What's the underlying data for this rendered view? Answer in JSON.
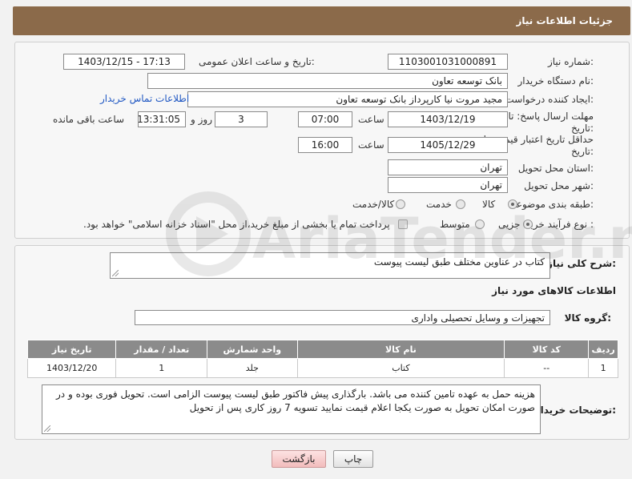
{
  "header": {
    "title": "جزئیات اطلاعات نیاز"
  },
  "form": {
    "need_number_label": "شماره نیاز:",
    "need_number": "1103001031000891",
    "announce_label": "تاریخ و ساعت اعلان عمومی:",
    "announce_value": "1403/12/15 - 17:13",
    "buyer_org_label": "نام دستگاه خریدار:",
    "buyer_org": "بانک توسعه تعاون",
    "requester_label": "ایجاد کننده درخواست:",
    "requester": "مجید مروت نیا کارپرداز بانک توسعه تعاون",
    "contact_link": "اطلاعات تماس خریدار",
    "deadline_label_1": "مهلت ارسال پاسخ: تا",
    "deadline_label_2": "تاریخ:",
    "deadline_date": "1403/12/19",
    "time_label": "ساعت",
    "deadline_time": "07:00",
    "days_value": "3",
    "days_label": "روز و",
    "remaining_time": "13:31:05",
    "remaining_label": "ساعت باقی مانده",
    "validity_label_1": "حداقل تاریخ اعتبار قیمت: تا",
    "validity_label_2": "تاریخ:",
    "validity_date": "1405/12/29",
    "validity_time": "16:00",
    "province_label": "استان محل تحویل:",
    "province": "تهران",
    "city_label": "شهر محل تحویل:",
    "city": "تهران",
    "category_label": "طبقه بندی موضوعی:",
    "category_options": [
      "کالا",
      "خدمت",
      "کالا/خدمت"
    ],
    "category_selected": "کالا",
    "process_label": "نوع فرآیند خرید :",
    "process_options": [
      "جزیی",
      "متوسط"
    ],
    "process_selected": "جزیی",
    "payment_note": "پرداخت تمام یا بخشی از مبلغ خرید،از محل \"اسناد خزانه اسلامی\" خواهد بود."
  },
  "details": {
    "summary_label": "شرح کلی نیاز:",
    "summary": "کتاب در عناوین مختلف طبق لیست پیوست",
    "goods_info_title": "اطلاعات کالاهای مورد نیاز",
    "goods_group_label": "گروه کالا:",
    "goods_group": "تجهیزات و وسایل تحصیلی واداری",
    "table_headers": [
      "ردیف",
      "کد کالا",
      "نام کالا",
      "واحد شمارش",
      "تعداد / مقدار",
      "تاریخ نیاز"
    ],
    "rows": [
      [
        "1",
        "--",
        "کتاب",
        "جلد",
        "1",
        "1403/12/20"
      ]
    ],
    "buyer_notes_label": "توضیحات خریدار:",
    "buyer_notes": "هزینه حمل به عهده تامین کننده می باشد. بارگذاری پیش فاکتور طبق لیست پیوست الزامی است. تحویل فوری بوده و در صورت امکان تحویل به صورت یکجا اعلام قیمت نمایید تسویه 7 روز کاری پس از تحویل"
  },
  "buttons": {
    "print": "چاپ",
    "back": "بازگشت"
  },
  "watermark": {
    "text": "AriaTender.net"
  },
  "colors": {
    "header": "#8b6a4a",
    "table_header": "#8b8b8b",
    "link": "#1f57c3",
    "back_button": "#f2bcbc"
  }
}
